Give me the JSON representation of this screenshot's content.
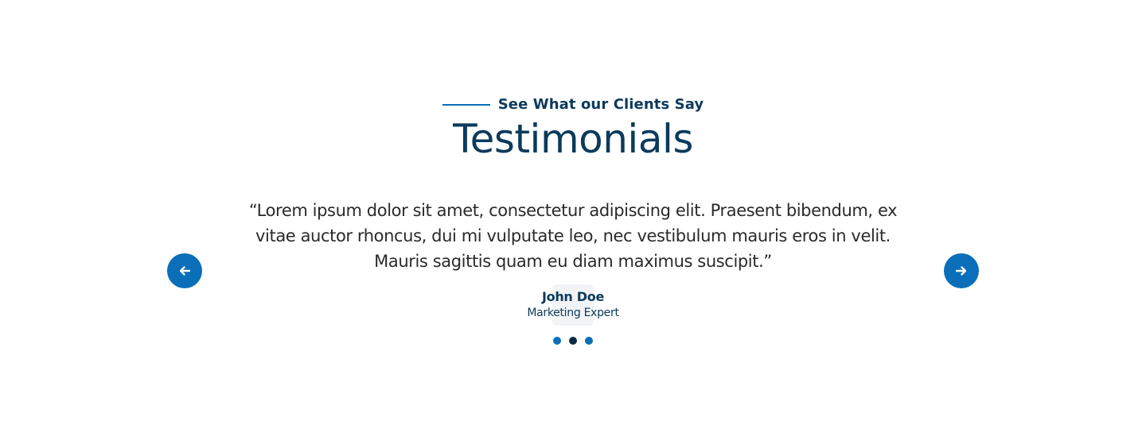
{
  "section": {
    "eyebrow": "See What our Clients Say",
    "title": "Testimonials"
  },
  "testimonial": {
    "quote": "“Lorem ipsum dolor sit amet, consectetur adipiscing elit. Praesent bibendum, ex vitae auctor rhoncus, dui mi vulputate leo, nec vestibulum mauris eros in velit. Mauris sagittis quam eu diam maximus suscipit.”",
    "author_name": "John Doe",
    "author_role": "Marketing Expert"
  },
  "navigation": {
    "prev_icon": "arrow-left-icon",
    "next_icon": "arrow-right-icon"
  },
  "pagination": {
    "total": 3,
    "active_index": 1
  },
  "colors": {
    "accent": "#0a6fb8",
    "heading": "#0b3a5c",
    "body_text": "#2a2a2a",
    "active_dot": "#0b2a44"
  }
}
